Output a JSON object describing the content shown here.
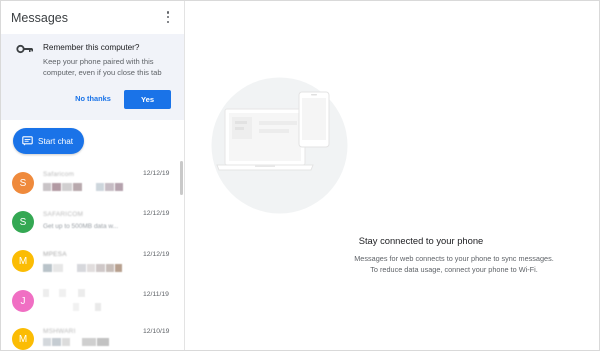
{
  "app": {
    "title": "Messages"
  },
  "remember_banner": {
    "title": "Remember this computer?",
    "body": "Keep your phone paired with this computer, even if you close this tab",
    "decline_label": "No thanks",
    "accept_label": "Yes"
  },
  "start_chat": {
    "label": "Start chat"
  },
  "conversations": [
    {
      "initial": "S",
      "color": "#ef8a3c",
      "name": "Safaricom",
      "date": "12/12/19"
    },
    {
      "initial": "S",
      "color": "#34a853",
      "name": "SAFARICOM",
      "preview": "Get up to 500MB data w...",
      "date": "12/12/19"
    },
    {
      "initial": "M",
      "color": "#fbbc04",
      "name": "MPESA",
      "date": "12/12/19"
    },
    {
      "initial": "J",
      "color": "#f06fc3",
      "date": "12/11/19"
    },
    {
      "initial": "M",
      "color": "#fbbc04",
      "name": "MSHWARI",
      "date": "12/10/19"
    }
  ],
  "empty_state": {
    "title": "Stay connected to your phone",
    "body_line1": "Messages for web connects to your phone to sync messages.",
    "body_line2": "To reduce data usage, connect your phone to Wi-Fi."
  },
  "colors": {
    "accent": "#1a73e8",
    "banner_bg": "#f1f3f9",
    "illustration_circle": "#f1f3f4"
  }
}
